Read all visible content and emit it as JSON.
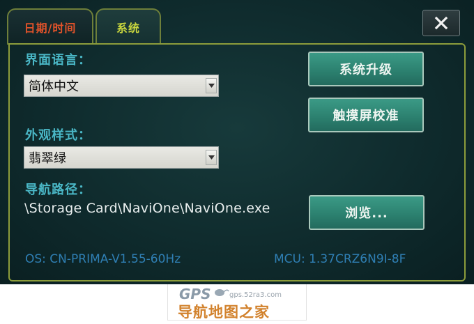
{
  "tabs": [
    {
      "label": "日期/时间",
      "color": "#e2532a"
    },
    {
      "label": "系统",
      "color": "#c9d63e",
      "active": true
    }
  ],
  "settings": {
    "language_label": "界面语言：",
    "language_value": "简体中文",
    "appearance_label": "外观样式：",
    "appearance_value": "翡翠绿",
    "nav_path_label": "导航路径：",
    "nav_path_value": "\\Storage Card\\NaviOne\\NaviOne.exe"
  },
  "buttons": {
    "upgrade": "系统升级",
    "calibrate": "触摸屏校准",
    "browse": "浏览..."
  },
  "status": {
    "os": "OS: CN-PRIMA-V1.55-60Hz",
    "mcu": "MCU: 1.37CRZ6N9I-8F"
  },
  "watermark": {
    "brand": "GPS",
    "url": "gps.52ra3.com",
    "name": "导航地图之家"
  },
  "icons": {
    "close": "close-icon",
    "dropdown": "chevron-down-icon"
  },
  "colors": {
    "accent_border": "#8d9d3b",
    "label": "#4ab7c6",
    "button": "#2b7f6e",
    "status": "#2f7fb4"
  }
}
